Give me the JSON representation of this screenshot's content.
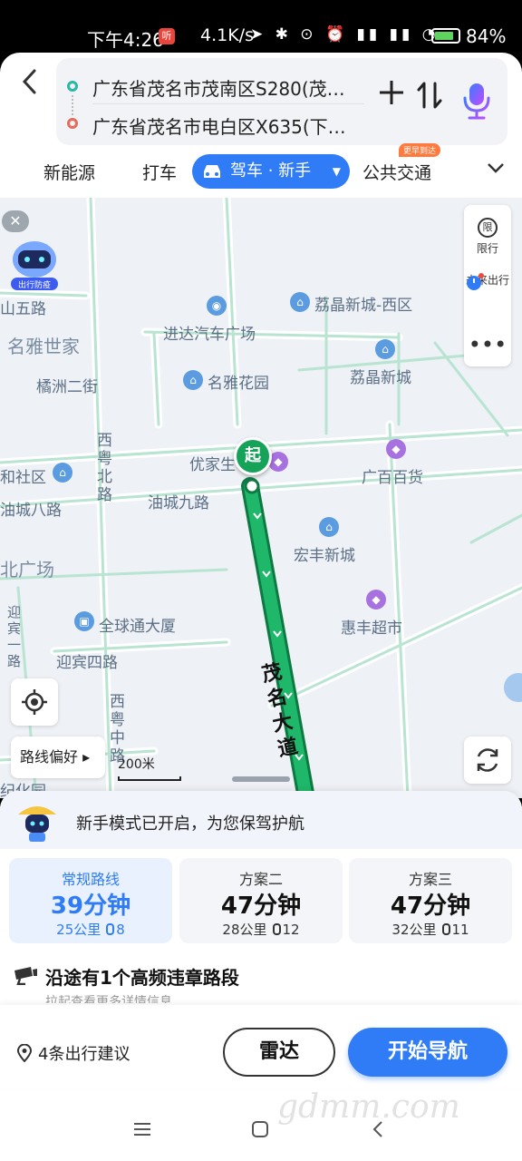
{
  "status_bar": {
    "time": "下午4:26",
    "badge": "听",
    "speed": "4.1K/s",
    "icons": "➤ ✱ ⊙ ⏰ ▮▮ ▮▮ ◔",
    "battery": "84%",
    "battery_level": 0.84
  },
  "route": {
    "from": "广东省茂名市茂南区S280(茂…",
    "to": "广东省茂名市电白区X635(下…"
  },
  "modes": {
    "new_energy": "新能源",
    "taxi": "打车",
    "drive": "驾车 · 新手",
    "transit": "公共交通",
    "transit_badge": "更早到达"
  },
  "map": {
    "start_marker": "起",
    "labels": {
      "shanwu": "山五路",
      "mingya_shijia": "名雅世家",
      "qiaozhou": "橘洲二街",
      "jinda": "进达汽车广场",
      "mingya_huayuan": "名雅花园",
      "lijing_west": "荔晶新城-西区",
      "lijing": "荔晶新城",
      "youjia": "优家生",
      "guangbai": "广百百货",
      "heshe": "和社区",
      "youcheng8": "油城八路",
      "youcheng9": "油城九路",
      "hongfeng": "宏丰新城",
      "guangchang": "北广场",
      "quanqiutong": "全球通大厦",
      "huifeng": "惠丰超市",
      "yingbin4": "迎宾四路",
      "yingbin_road": "迎宾一路",
      "xiyue_bei": "西粤北路",
      "xiyue_zhong": "西粤中路",
      "jihua": "纪化园",
      "route_road": "茂名大道"
    },
    "side_panel": {
      "limit": "限行",
      "limit_icon": "限",
      "future": "未来出行",
      "more": "•••"
    },
    "route_pref": "路线偏好 ▸",
    "scale": "200米",
    "close": "✕"
  },
  "sheet": {
    "notice": "新手模式已开启，为您保驾护航",
    "plans": [
      {
        "name": "常规路线",
        "time": "39分钟",
        "distance": "25公里",
        "lights": "8"
      },
      {
        "name": "方案二",
        "time": "47分钟",
        "distance": "28公里",
        "lights": "12"
      },
      {
        "name": "方案三",
        "time": "47分钟",
        "distance": "32公里",
        "lights": "11"
      }
    ],
    "violation_title": "沿途有1个高频违章路段",
    "violation_sub": "拉起查看更多详情信息",
    "tips": "4条出行建议",
    "radar": "雷达",
    "navigate": "开始导航",
    "watermark": "gdmm.com"
  },
  "colors": {
    "accent": "#2f7cf6",
    "route": "#15a35a",
    "road": "#b9e4d2"
  }
}
